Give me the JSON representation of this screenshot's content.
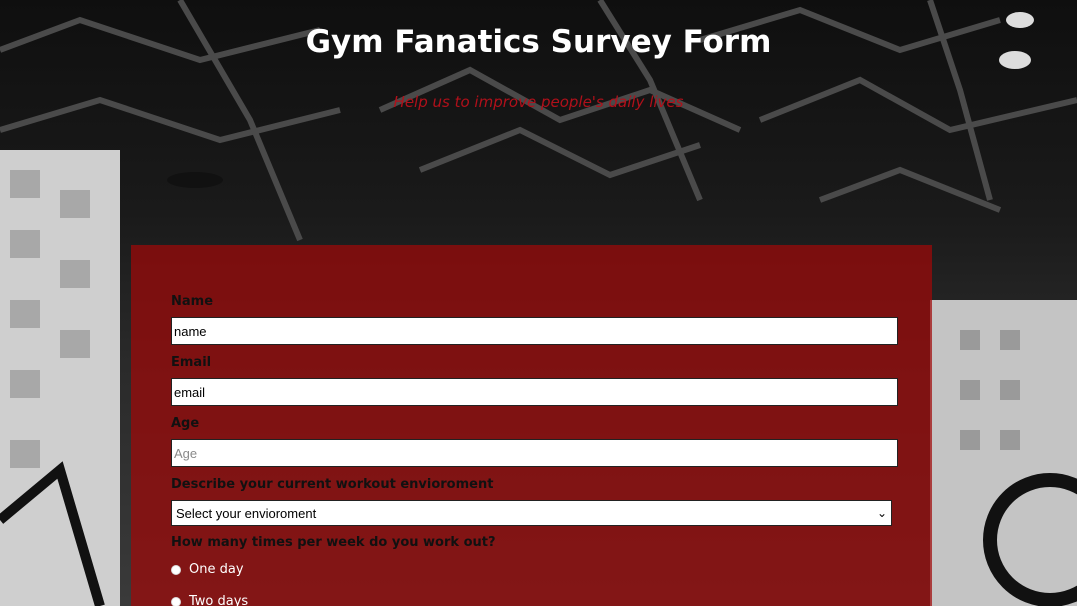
{
  "header": {
    "title": "Gym Fanatics Survey Form",
    "description": "Help us to improve people's daily lives"
  },
  "form": {
    "name": {
      "label": "Name",
      "value": "name"
    },
    "email": {
      "label": "Email",
      "value": "email"
    },
    "age": {
      "label": "Age",
      "placeholder": "Age"
    },
    "environment": {
      "label": "Describe your current workout envioroment",
      "selected": "Select your envioroment"
    },
    "frequency": {
      "question": "How many times per week do you work out?",
      "options": [
        "One day",
        "Two days"
      ]
    }
  },
  "colors": {
    "panel": "#a00808",
    "subtitle": "#b0101a"
  }
}
